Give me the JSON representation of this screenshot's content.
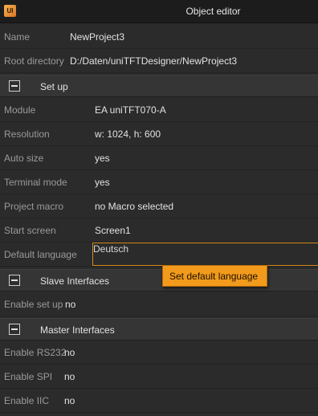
{
  "window": {
    "title": "Object editor",
    "app_icon": "unitft-app-icon"
  },
  "project": {
    "name_label": "Name",
    "name_value": "NewProject3",
    "root_label": "Root directory",
    "root_value": "D:/Daten/uniTFTDesigner/NewProject3"
  },
  "setup": {
    "title": "Set up",
    "module_label": "Module",
    "module_value": "EA uniTFT070-A",
    "resolution_label": "Resolution",
    "resolution_value": "w: 1024,  h: 600",
    "autosize_label": "Auto size",
    "autosize_value": "yes",
    "terminal_label": "Terminal mode",
    "terminal_value": "yes",
    "macro_label": "Project macro",
    "macro_value": "no Macro selected",
    "startscreen_label": "Start screen",
    "startscreen_value": "Screen1",
    "language_label": "Default language",
    "language_value": "Deutsch",
    "language_tooltip": "Set default language"
  },
  "slave": {
    "title": "Slave Interfaces",
    "enable_setup_label": "Enable set up",
    "enable_setup_value": "no"
  },
  "master": {
    "title": "Master Interfaces",
    "rs232_label": "Enable RS232",
    "rs232_value": "no",
    "spi_label": "Enable SPI",
    "spi_value": "no",
    "iic_label": "Enable IIC",
    "iic_value": "no"
  },
  "colors": {
    "accent": "#f29a1c",
    "background": "#2b2b2b",
    "section": "#353535"
  }
}
